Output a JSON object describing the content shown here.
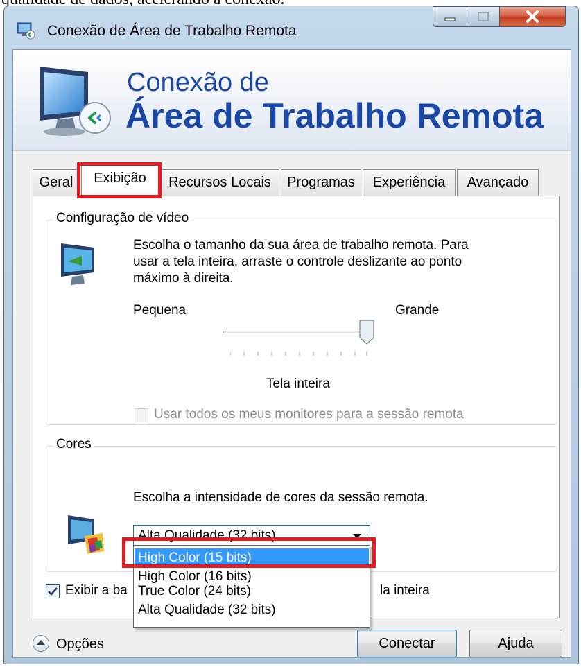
{
  "document_text": "qualidade de dados, acelerando a conexão.",
  "window": {
    "title": "Conexão de Área de Trabalho Remota"
  },
  "banner": {
    "line1": "Conexão de",
    "line2": "Área de Trabalho Remota"
  },
  "tabs": [
    {
      "label": "Geral",
      "active": false
    },
    {
      "label": "Exibição",
      "active": true
    },
    {
      "label": "Recursos Locais",
      "active": false
    },
    {
      "label": "Programas",
      "active": false
    },
    {
      "label": "Experiência",
      "active": false
    },
    {
      "label": "Avançado",
      "active": false
    }
  ],
  "video": {
    "group_title": "Configuração de vídeo",
    "desc_line1": "Escolha o tamanho da sua área de trabalho remota. Para",
    "desc_line2": "usar a tela inteira, arraste o controle deslizante ao ponto",
    "desc_line3": "máximo à direita.",
    "slider_min_label": "Pequena",
    "slider_max_label": "Grande",
    "slider_value_label": "Tela inteira",
    "slider_level": 1.0,
    "multimon_label": "Usar todos os meus monitores para a sessão remota",
    "multimon_checked": false,
    "multimon_enabled": false
  },
  "colors": {
    "group_title": "Cores",
    "desc": "Escolha a intensidade de cores da sessão remota.",
    "selected": "Alta Qualidade (32 bits)",
    "options": [
      "High Color (15 bits)",
      "High Color (16 bits)",
      "True Color (24 bits)",
      "Alta Qualidade (32 bits)"
    ],
    "highlighted_option": 0
  },
  "connection_bar": {
    "label_left": "Exibir a ba",
    "label_right": "la inteira",
    "checked": true
  },
  "bottom": {
    "options_label": "Opções",
    "connect_label": "Conectar",
    "help_label": "Ajuda"
  },
  "colors_ui": {
    "accent": "#1a48a4",
    "highlight_box": "#e31b23",
    "selection": "#3399ff"
  }
}
